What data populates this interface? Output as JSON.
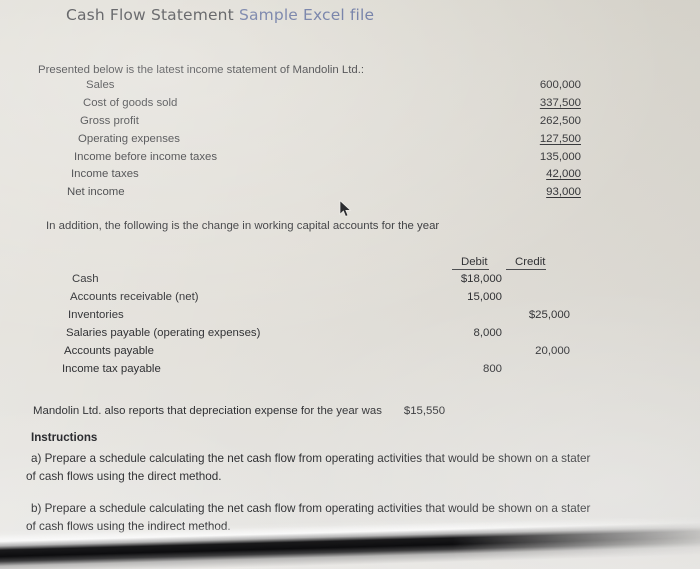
{
  "title": {
    "main": "Cash Flow Statement ",
    "accent": "Sample Excel file"
  },
  "intro_text": "Presented below is the latest income statement of Mandolin Ltd.:",
  "income_statement": {
    "rows": [
      {
        "label": "Sales",
        "amount": "600,000",
        "underline": false,
        "indent": 86
      },
      {
        "label": "Cost of goods sold",
        "amount": "337,500",
        "underline": true,
        "indent": 83
      },
      {
        "label": "Gross profit",
        "amount": "262,500",
        "underline": false,
        "indent": 80
      },
      {
        "label": "Operating expenses",
        "amount": "127,500",
        "underline": true,
        "indent": 78
      },
      {
        "label": "Income before income taxes",
        "amount": "135,000",
        "underline": false,
        "indent": 74
      },
      {
        "label": "Income taxes",
        "amount": "42,000",
        "underline": true,
        "indent": 71
      },
      {
        "label": "Net income",
        "amount": "93,000",
        "underline": true,
        "indent": 67
      }
    ]
  },
  "addendum_text": "In addition, the following is the change in working capital accounts for the year",
  "working_capital": {
    "headers": {
      "debit": "Debit",
      "credit": "Credit"
    },
    "rows": [
      {
        "label": "Cash",
        "debit": "$18,000",
        "credit": "",
        "indent": 72
      },
      {
        "label": "Accounts receivable (net)",
        "debit": "15,000",
        "credit": "",
        "indent": 70
      },
      {
        "label": "Inventories",
        "debit": "",
        "credit": "$25,000",
        "indent": 68
      },
      {
        "label": "Salaries payable (operating expenses)",
        "debit": "8,000",
        "credit": "",
        "indent": 66
      },
      {
        "label": "Accounts payable",
        "debit": "",
        "credit": "20,000",
        "indent": 64
      },
      {
        "label": "Income tax payable",
        "debit": "800",
        "credit": "",
        "indent": 62
      }
    ]
  },
  "depreciation": {
    "text": "Mandolin Ltd. also reports that depreciation expense for the year was",
    "amount": "$15,550"
  },
  "instructions": {
    "heading": "Instructions",
    "items": [
      {
        "line1": "a) Prepare a schedule calculating the net cash flow from operating activities that would be shown on a stater",
        "line2": "of cash flows using the direct method."
      },
      {
        "line1": "b) Prepare a schedule calculating the net cash flow from operating activities that would be shown on a stater",
        "line2": "of cash flows using the indirect method."
      }
    ]
  },
  "icons": {
    "cursor": "mouse-pointer-icon"
  },
  "colors": {
    "paper": "#e0ddd6",
    "text": "#2f3033",
    "title_accent": "#5d6b99"
  }
}
